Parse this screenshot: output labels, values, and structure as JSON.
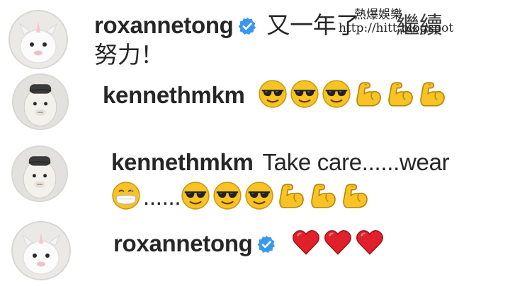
{
  "comments": [
    {
      "username": "roxannetong",
      "verified": true,
      "text_line1": "又一年了",
      "text_line1_tail": "繼續",
      "text_line2": "努力！",
      "avatar": "plush-unicorn-avatar"
    },
    {
      "username": "kennethmkm",
      "verified": false,
      "emojis": [
        "sunglasses-face-emoji",
        "sunglasses-face-emoji",
        "sunglasses-face-emoji",
        "flexed-biceps-emoji",
        "flexed-biceps-emoji",
        "flexed-biceps-emoji"
      ],
      "avatar": "plush-toy-avatar"
    },
    {
      "username": "kennethmkm",
      "verified": false,
      "text_line1": "Take care......wear",
      "text_line2_dots": "......",
      "emojis_line2_first": "mask-face-emoji",
      "emojis_line2": [
        "sunglasses-face-emoji",
        "sunglasses-face-emoji",
        "sunglasses-face-emoji",
        "flexed-biceps-emoji",
        "flexed-biceps-emoji",
        "flexed-biceps-emoji"
      ],
      "avatar": "plush-toy-avatar"
    },
    {
      "username": "roxannetong",
      "verified": true,
      "emojis": [
        "red-heart-emoji",
        "red-heart-emoji",
        "red-heart-emoji"
      ],
      "avatar": "plush-unicorn-avatar"
    }
  ],
  "watermark": {
    "title": "熱爆娛樂",
    "url": "http://hitt.blogspot"
  },
  "colors": {
    "verified_blue": "#3897f0",
    "text": "#262626",
    "emoji_yellow": "#f7c325",
    "heart_red": "#e0202a"
  }
}
